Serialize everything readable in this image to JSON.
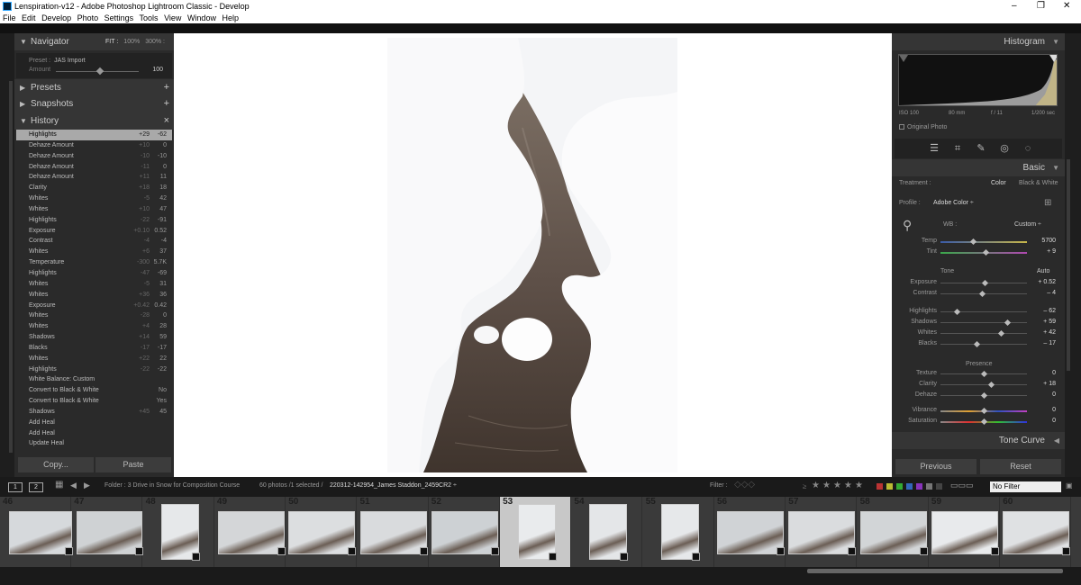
{
  "window": {
    "title": "Lenspiration-v12 - Adobe Photoshop Lightroom Classic - Develop",
    "controls": [
      "–",
      "❐",
      "✕"
    ]
  },
  "menu": [
    "File",
    "Edit",
    "Develop",
    "Photo",
    "Settings",
    "Tools",
    "View",
    "Window",
    "Help"
  ],
  "left": {
    "navigator": {
      "title": "Navigator",
      "fit": "FIT :",
      "zoom1": "100%",
      "zoom2": "300% :"
    },
    "preset": {
      "label": "Preset :",
      "name": "JAS Import",
      "amount_label": "Amount",
      "amount_value": "100"
    },
    "presets": "Presets",
    "snapshots": "Snapshots",
    "history_title": "History",
    "history": [
      {
        "name": "Highlights",
        "a": "+29",
        "b": "-62"
      },
      {
        "name": "Dehaze Amount",
        "a": "+10",
        "b": "0"
      },
      {
        "name": "Dehaze Amount",
        "a": "-10",
        "b": "-10"
      },
      {
        "name": "Dehaze Amount",
        "a": "-11",
        "b": "0"
      },
      {
        "name": "Dehaze Amount",
        "a": "+11",
        "b": "11"
      },
      {
        "name": "Clarity",
        "a": "+18",
        "b": "18"
      },
      {
        "name": "Whites",
        "a": "-5",
        "b": "42"
      },
      {
        "name": "Whites",
        "a": "+10",
        "b": "47"
      },
      {
        "name": "Highlights",
        "a": "-22",
        "b": "-91"
      },
      {
        "name": "Exposure",
        "a": "+0.10",
        "b": "0.52"
      },
      {
        "name": "Contrast",
        "a": "-4",
        "b": "-4"
      },
      {
        "name": "Whites",
        "a": "+6",
        "b": "37"
      },
      {
        "name": "Temperature",
        "a": "-300",
        "b": "5.7K"
      },
      {
        "name": "Highlights",
        "a": "-47",
        "b": "-69"
      },
      {
        "name": "Whites",
        "a": "-5",
        "b": "31"
      },
      {
        "name": "Whites",
        "a": "+36",
        "b": "36"
      },
      {
        "name": "Exposure",
        "a": "+0.42",
        "b": "0.42"
      },
      {
        "name": "Whites",
        "a": "-28",
        "b": "0"
      },
      {
        "name": "Whites",
        "a": "+4",
        "b": "28"
      },
      {
        "name": "Shadows",
        "a": "+14",
        "b": "59"
      },
      {
        "name": "Blacks",
        "a": "-17",
        "b": "-17"
      },
      {
        "name": "Whites",
        "a": "+22",
        "b": "22"
      },
      {
        "name": "Highlights",
        "a": "-22",
        "b": "-22"
      },
      {
        "name": "White Balance: Custom",
        "a": "",
        "b": ""
      },
      {
        "name": "Convert to Black & White",
        "a": "",
        "b": "No"
      },
      {
        "name": "Convert to Black & White",
        "a": "",
        "b": "Yes"
      },
      {
        "name": "Shadows",
        "a": "+45",
        "b": "45"
      },
      {
        "name": "Add Heal",
        "a": "",
        "b": ""
      },
      {
        "name": "Add Heal",
        "a": "",
        "b": ""
      },
      {
        "name": "Update Heal",
        "a": "",
        "b": ""
      }
    ],
    "copy": "Copy...",
    "paste": "Paste"
  },
  "right": {
    "histogram_title": "Histogram",
    "info": {
      "iso": "ISO 100",
      "focal": "80 mm",
      "fstop": "f / 11",
      "shutter": "1/200 sec"
    },
    "original_photo": "Original Photo",
    "basic_title": "Basic",
    "treatment_label": "Treatment :",
    "treatment_color": "Color",
    "treatment_bw": "Black & White",
    "profile_label": "Profile :",
    "profile_value": "Adobe Color ÷",
    "wb_label": "WB :",
    "wb_value": "Custom ÷",
    "temp": {
      "label": "Temp",
      "value": "5700",
      "pos": 0.38
    },
    "tint": {
      "label": "Tint",
      "value": "+ 9",
      "pos": 0.53
    },
    "tone_label": "Tone",
    "auto": "Auto",
    "tone": [
      {
        "label": "Exposure",
        "value": "+ 0.52",
        "pos": 0.52
      },
      {
        "label": "Contrast",
        "value": "– 4",
        "pos": 0.48
      }
    ],
    "tone2": [
      {
        "label": "Highlights",
        "value": "– 62",
        "pos": 0.19
      },
      {
        "label": "Shadows",
        "value": "+ 59",
        "pos": 0.78
      },
      {
        "label": "Whites",
        "value": "+ 42",
        "pos": 0.7
      },
      {
        "label": "Blacks",
        "value": "– 17",
        "pos": 0.42
      }
    ],
    "presence_label": "Presence",
    "presence": [
      {
        "label": "Texture",
        "value": "0",
        "pos": 0.5
      },
      {
        "label": "Clarity",
        "value": "+ 18",
        "pos": 0.59
      },
      {
        "label": "Dehaze",
        "value": "0",
        "pos": 0.5
      }
    ],
    "color": [
      {
        "label": "Vibrance",
        "value": "0",
        "pos": 0.5
      },
      {
        "label": "Saturation",
        "value": "0",
        "pos": 0.5
      }
    ],
    "tonecurve_title": "Tone Curve",
    "previous": "Previous",
    "reset": "Reset"
  },
  "filmbar": {
    "mon1": "1",
    "mon2": "2",
    "folder": "Folder : 3 Drive in Snow for Composition Course",
    "count": "60 photos /1 selected /",
    "filename": "220312-142954_James Staddon_2459CR2 ÷",
    "filter_label": "Filter :",
    "no_filter": "No Filter"
  },
  "filmstrip": [
    "46",
    "47",
    "48",
    "49",
    "50",
    "51",
    "52",
    "53",
    "54",
    "55",
    "56",
    "57",
    "58",
    "59",
    "60"
  ],
  "colors": {
    "accent": "#a9a9a9",
    "panel": "#2a2a2a",
    "header": "#353535"
  }
}
